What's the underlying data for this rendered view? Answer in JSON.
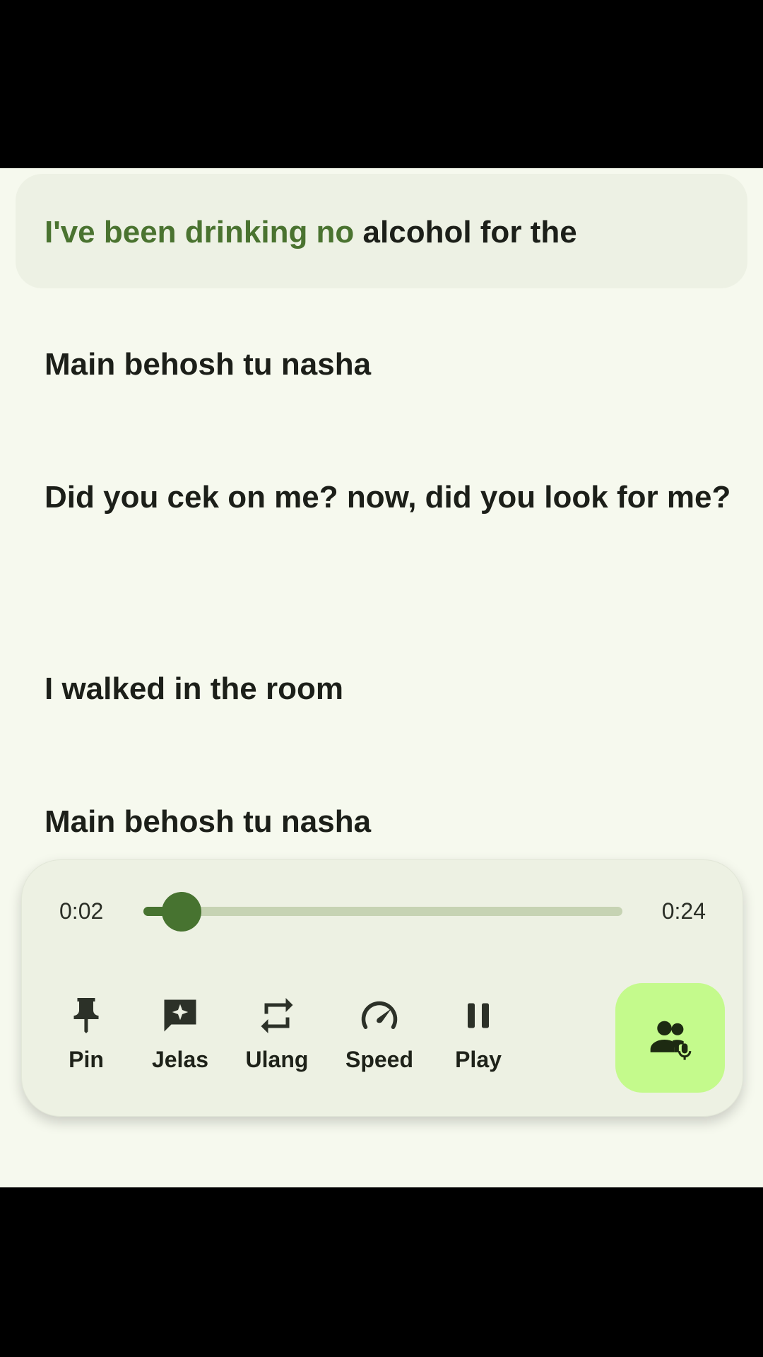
{
  "lyrics": {
    "active_highlight": "I've been drinking no",
    "active_rest": " alcohol for the",
    "lines": [
      "Main behosh tu nasha",
      "Did you cek on me? now, did you look for me?",
      "I walked in the room",
      "Main behosh tu  nasha"
    ]
  },
  "player": {
    "current_time": "0:02",
    "total_time": "0:24",
    "progress_fraction": 0.08,
    "controls": [
      {
        "icon": "pin-icon",
        "label": "Pin"
      },
      {
        "icon": "sparkle-chat-icon",
        "label": "Jelas"
      },
      {
        "icon": "repeat-icon",
        "label": "Ulang"
      },
      {
        "icon": "speedometer-icon",
        "label": "Speed"
      },
      {
        "icon": "pause-icon",
        "label": "Play"
      }
    ],
    "fab_icon": "voice-people-icon"
  },
  "colors": {
    "accent": "#477330",
    "highlight_text": "#4a7330",
    "fab_background": "#c4fa8c",
    "background": "#f6f9ee"
  }
}
